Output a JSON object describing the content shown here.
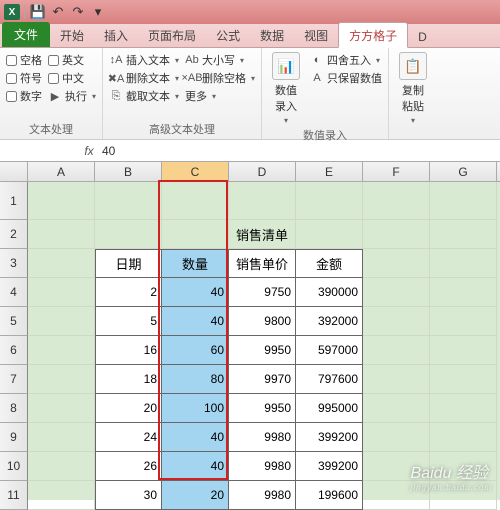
{
  "qat": {
    "save": "💾",
    "undo": "↶",
    "redo": "↷"
  },
  "tabs": {
    "file": "文件",
    "items": [
      "开始",
      "插入",
      "页面布局",
      "公式",
      "数据",
      "视图",
      "方方格子"
    ],
    "active_index": 6,
    "last_partial": "D"
  },
  "ribbon": {
    "group1": {
      "label": "文本处理",
      "col1": [
        "空格",
        "符号",
        "数字"
      ],
      "col2": [
        "英文",
        "中文",
        "执行"
      ]
    },
    "group2": {
      "label": "高级文本处理",
      "col1": [
        {
          "icon": "↕A",
          "label": "插入文本"
        },
        {
          "icon": "✖A",
          "label": "删除文本"
        },
        {
          "icon": "⎘",
          "label": "截取文本"
        }
      ],
      "col2": [
        {
          "icon": "Ab",
          "label": "大小写"
        },
        {
          "icon": "×AB",
          "label": "删除空格"
        },
        {
          "icon": "",
          "label": "更多"
        }
      ]
    },
    "group3": {
      "label": "数值录入",
      "big": {
        "icon": "📊",
        "label": "数值\n录入"
      },
      "col": [
        {
          "icon": "◐",
          "label": "四舍五入"
        },
        {
          "icon": "A",
          "label": "只保留数值"
        }
      ]
    },
    "group4": {
      "big": {
        "icon": "📋",
        "label": "复制\n粘贴"
      }
    }
  },
  "formula_bar": {
    "fx": "fx",
    "value": "40"
  },
  "columns": [
    "A",
    "B",
    "C",
    "D",
    "E",
    "F",
    "G"
  ],
  "selected_col": "C",
  "title_cell": "销售清单",
  "headers": [
    "日期",
    "数量",
    "销售单价",
    "金额"
  ],
  "chart_data": {
    "type": "table",
    "title": "销售清单",
    "columns": [
      "日期",
      "数量",
      "销售单价",
      "金额"
    ],
    "rows": [
      {
        "日期": 2,
        "数量": 40,
        "销售单价": 9750,
        "金额": 390000
      },
      {
        "日期": 5,
        "数量": 40,
        "销售单价": 9800,
        "金额": 392000
      },
      {
        "日期": 16,
        "数量": 60,
        "销售单价": 9950,
        "金额": 597000
      },
      {
        "日期": 18,
        "数量": 80,
        "销售单价": 9970,
        "金额": 797600
      },
      {
        "日期": 20,
        "数量": 100,
        "销售单价": 9950,
        "金额": 995000
      },
      {
        "日期": 24,
        "数量": 40,
        "销售单价": 9980,
        "金额": 399200
      },
      {
        "日期": 26,
        "数量": 40,
        "销售单价": 9980,
        "金额": 399200
      },
      {
        "日期": 30,
        "数量": 20,
        "销售单价": 9980,
        "金额": 199600
      }
    ]
  },
  "watermark": {
    "brand": "Baidu 经验",
    "url": "jingyan.baidu.com"
  }
}
